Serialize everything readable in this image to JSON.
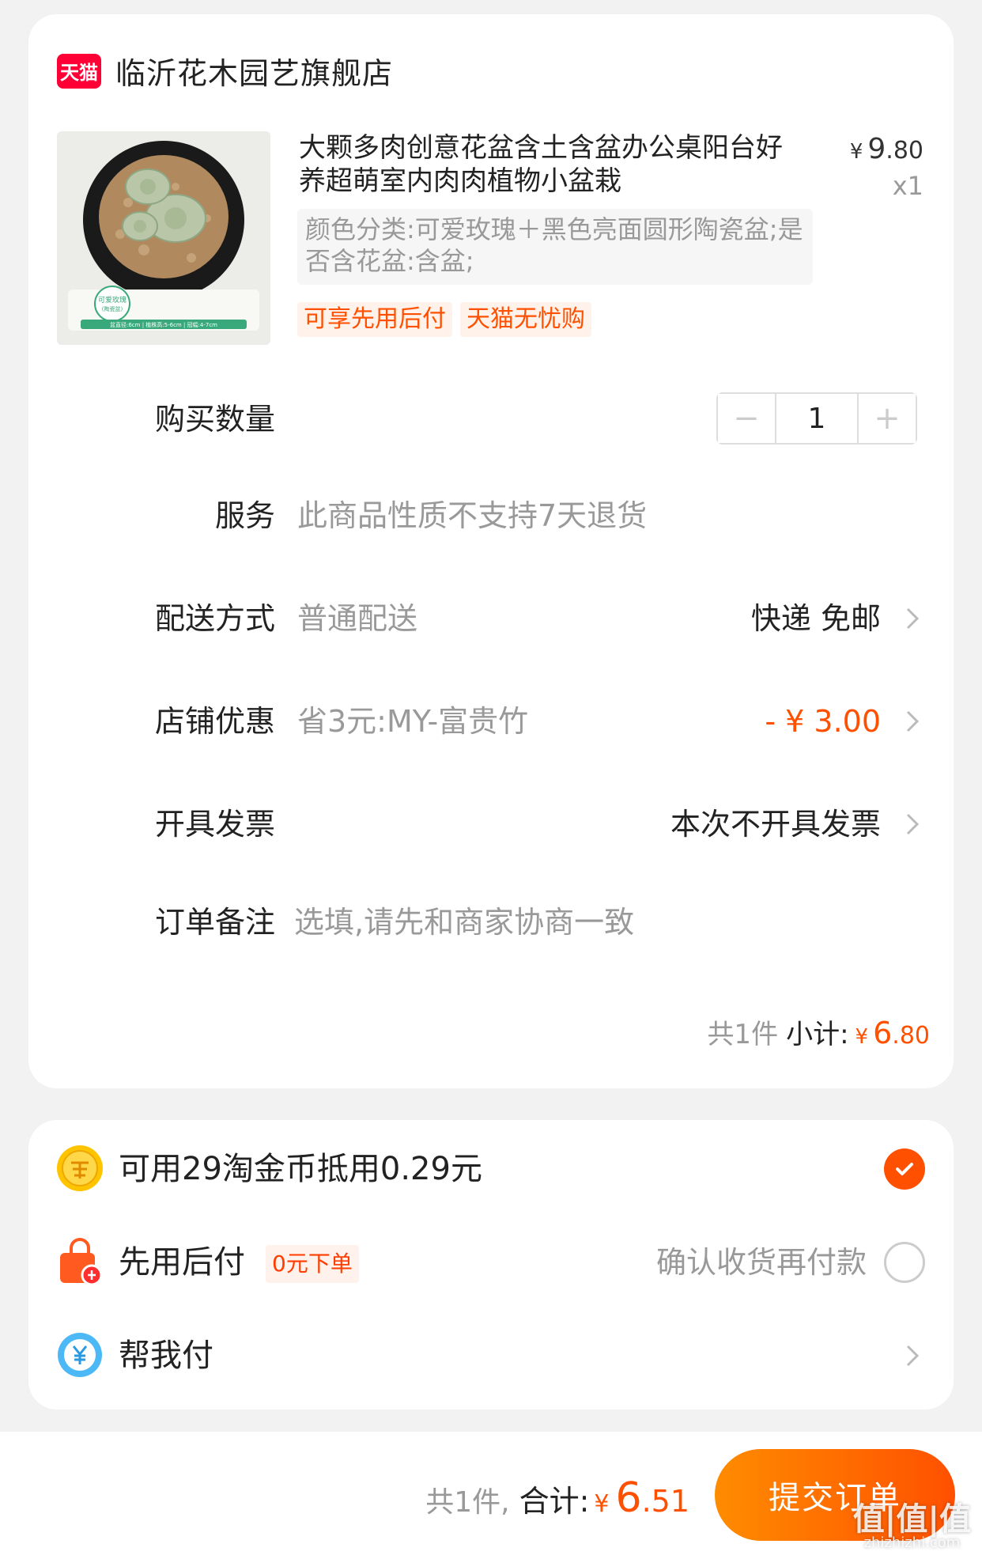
{
  "shop": {
    "logo_text": "天猫",
    "name": "临沂花木园艺旗舰店"
  },
  "product": {
    "title": "大颗多肉创意花盆含土含盆办公桌阳台好养超萌室内肉肉植物小盆栽",
    "price_currency": "¥",
    "price_int": "9",
    "price_dec": ".80",
    "quantity": "x1",
    "sku": "颜色分类:可爱玫瑰＋黑色亮面圆形陶瓷盆;是否含花盆:含盆;",
    "tags": [
      "可享先用后付",
      "天猫无忧购"
    ],
    "image_label": "可爱玫瑰",
    "image_sublabel": "(陶瓷盆)",
    "image_specs": "盆直径:6cm | 植株高:5-6cm | 冠幅:4-7cm"
  },
  "rows": {
    "quantity": {
      "label": "购买数量",
      "value": "1",
      "minus": "−",
      "plus": "+"
    },
    "service": {
      "label": "服务",
      "value": "此商品性质不支持7天退货"
    },
    "delivery": {
      "label": "配送方式",
      "value": "普通配送",
      "right": "快递 免邮"
    },
    "shop_discount": {
      "label": "店铺优惠",
      "value": "省3元:MY-富贵竹",
      "right": "- ¥ 3.00"
    },
    "invoice": {
      "label": "开具发票",
      "right": "本次不开具发票"
    },
    "note": {
      "label": "订单备注",
      "placeholder": "选填,请先和商家协商一致"
    }
  },
  "subtotal": {
    "count": "共1件",
    "label": "小计:",
    "currency": "¥",
    "int": "6",
    "dec": ".80"
  },
  "payment": {
    "coins": {
      "text": "可用29淘金币抵用0.29元",
      "checked": true
    },
    "pay_later": {
      "text": "先用后付",
      "badge": "0元下单",
      "right": "确认收货再付款",
      "checked": false
    },
    "help_pay": {
      "text": "帮我付"
    }
  },
  "footer": {
    "count": "共1件,",
    "label": "合计:",
    "currency": "¥",
    "int": "6",
    "dec": ".51",
    "submit": "提交订单",
    "watermark": "值|值|值",
    "watermark_sub": "zhizhizhi.com"
  },
  "colors": {
    "accent": "#ff5000",
    "tmall": "#ff0036",
    "background": "#f2f2f2"
  }
}
